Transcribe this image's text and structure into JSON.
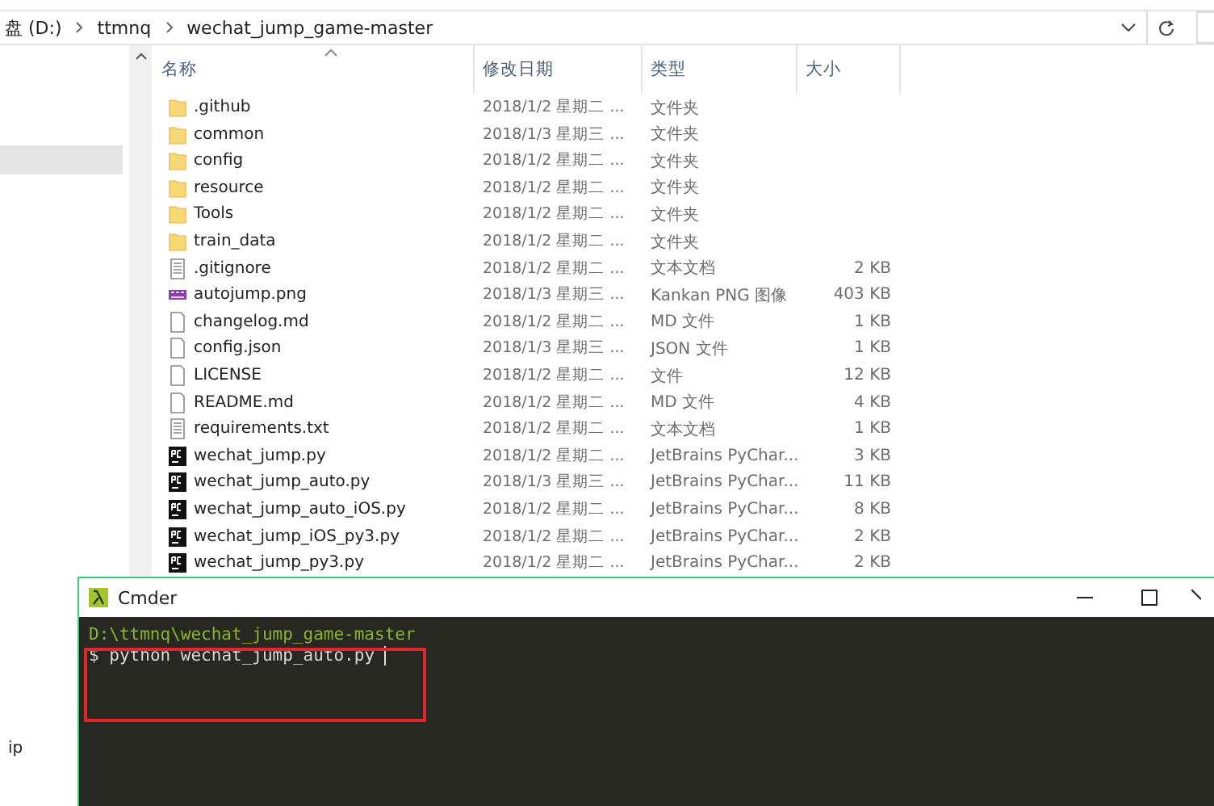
{
  "address_bar": {
    "path": [
      {
        "label": "盘 (D:)"
      },
      {
        "label": "ttmnq"
      },
      {
        "label": "wechat_jump_game-master"
      }
    ]
  },
  "columns": [
    "名称",
    "修改日期",
    "类型",
    "大小"
  ],
  "files": [
    {
      "kind": "folder",
      "name": ".github",
      "date": "2018/1/2 星期二 ...",
      "type": "文件夹"
    },
    {
      "kind": "folder",
      "name": "common",
      "date": "2018/1/3 星期三 ...",
      "type": "文件夹"
    },
    {
      "kind": "folder",
      "name": "config",
      "date": "2018/1/2 星期二 ...",
      "type": "文件夹"
    },
    {
      "kind": "folder",
      "name": "resource",
      "date": "2018/1/2 星期二 ...",
      "type": "文件夹"
    },
    {
      "kind": "folder",
      "name": "Tools",
      "date": "2018/1/2 星期二 ...",
      "type": "文件夹"
    },
    {
      "kind": "folder",
      "name": "train_data",
      "date": "2018/1/2 星期二 ...",
      "type": "文件夹"
    },
    {
      "kind": "text",
      "name": ".gitignore",
      "date": "2018/1/2 星期二 ...",
      "type": "文本文档",
      "size": "2 KB"
    },
    {
      "kind": "image",
      "name": "autojump.png",
      "date": "2018/1/3 星期三 ...",
      "type": "Kankan PNG 图像",
      "size": "403 KB"
    },
    {
      "kind": "file",
      "name": "changelog.md",
      "date": "2018/1/2 星期二 ...",
      "type": "MD 文件",
      "size": "1 KB"
    },
    {
      "kind": "file",
      "name": "config.json",
      "date": "2018/1/3 星期三 ...",
      "type": "JSON 文件",
      "size": "1 KB"
    },
    {
      "kind": "file",
      "name": "LICENSE",
      "date": "2018/1/2 星期二 ...",
      "type": "文件",
      "size": "12 KB"
    },
    {
      "kind": "file",
      "name": "README.md",
      "date": "2018/1/2 星期二 ...",
      "type": "MD 文件",
      "size": "4 KB"
    },
    {
      "kind": "text",
      "name": "requirements.txt",
      "date": "2018/1/2 星期二 ...",
      "type": "文本文档",
      "size": "1 KB"
    },
    {
      "kind": "python",
      "name": "wechat_jump.py",
      "date": "2018/1/2 星期二 ...",
      "type": "JetBrains PyChar...",
      "size": "3 KB"
    },
    {
      "kind": "python",
      "name": "wechat_jump_auto.py",
      "date": "2018/1/3 星期三 ...",
      "type": "JetBrains PyChar...",
      "size": "11 KB"
    },
    {
      "kind": "python",
      "name": "wechat_jump_auto_iOS.py",
      "date": "2018/1/2 星期二 ...",
      "type": "JetBrains PyChar...",
      "size": "8 KB"
    },
    {
      "kind": "python",
      "name": "wechat_jump_iOS_py3.py",
      "date": "2018/1/2 星期二 ...",
      "type": "JetBrains PyChar...",
      "size": "2 KB"
    },
    {
      "kind": "python",
      "name": "wechat_jump_py3.py",
      "date": "2018/1/2 星期二 ...",
      "type": "JetBrains PyChar...",
      "size": "2 KB"
    }
  ],
  "side_label": "ip",
  "terminal": {
    "title": "Cmder",
    "cwd": "D:\\ttmnq\\wechat_jump_game-master",
    "prompt": "$",
    "command": "python wechat_jump_auto.py"
  }
}
